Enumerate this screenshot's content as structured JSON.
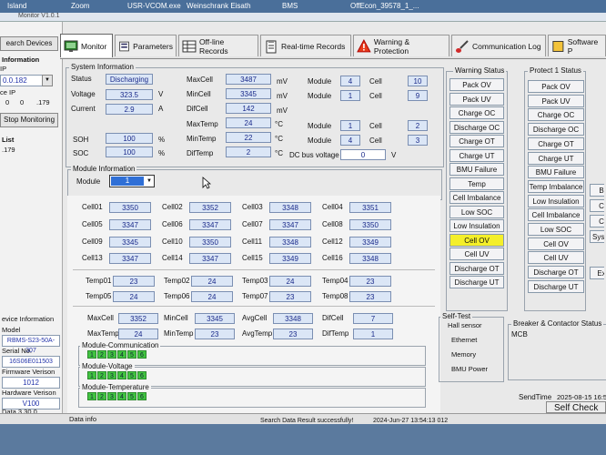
{
  "desktop": {
    "items": [
      "Island",
      "Zoom",
      "USR-VCOM.exe",
      "Weinschrank Eisath",
      "BMS",
      "OffEcon_39578_1_..."
    ]
  },
  "window": {
    "title": "Monitor V1.0.1"
  },
  "tabs": [
    {
      "label": "Monitor",
      "icon": "monitor-icon"
    },
    {
      "label": "Parameters",
      "icon": "parameters-icon"
    },
    {
      "label": "Off-line Records",
      "icon": "table-icon"
    },
    {
      "label": "Real-time Records",
      "icon": "clipboard-icon"
    },
    {
      "label": "Warning & Protection",
      "icon": "warning-icon"
    },
    {
      "label": "Communication Log",
      "icon": "brush-icon"
    },
    {
      "label": "Software P",
      "icon": "software-icon"
    }
  ],
  "left": {
    "search_devices": "earch Devices",
    "information": "Information",
    "ip_label": "IP",
    "ip_value": "0.0.182",
    "ce_ip": "ce IP",
    "ce_ip_parts": [
      "0",
      "0",
      ".179"
    ],
    "stop_monitoring": "Stop Monitoring",
    "list_label": "List",
    "list_item": ".179",
    "device_information": "evice Information",
    "model_label": "Model",
    "model_value": "RBMS-S23-50A-307",
    "serial_label": "Serial No.",
    "serial_value": "16S06E011503",
    "firmware_label": "Firmware Verison",
    "firmware_value": "1012",
    "hardware_label": "Hardware Verison",
    "hardware_value": "V100",
    "date_version": "Data 3.30.0"
  },
  "system_info": {
    "title": "System Information",
    "status_label": "Status",
    "status_value": "Discharging",
    "voltage_label": "Voltage",
    "voltage_value": "323.5",
    "voltage_unit": "V",
    "current_label": "Current",
    "current_value": "2.9",
    "current_unit": "A",
    "soh_label": "SOH",
    "soh_value": "100",
    "soh_unit": "%",
    "soc_label": "SOC",
    "soc_value": "100",
    "soc_unit": "%",
    "maxcell_label": "MaxCell",
    "maxcell_value": "3487",
    "maxcell_unit": "mV",
    "mincell_label": "MinCell",
    "mincell_value": "3345",
    "mincell_unit": "mV",
    "difcell_label": "DifCell",
    "difcell_value": "142",
    "difcell_unit": "mV",
    "maxtemp_label": "MaxTemp",
    "maxtemp_value": "24",
    "maxtemp_unit": "°C",
    "mintemp_label": "MinTemp",
    "mintemp_value": "22",
    "mintemp_unit": "°C",
    "diftemp_label": "DifTemp",
    "diftemp_value": "2",
    "diftemp_unit": "°C",
    "module_label": "Module",
    "cell_label": "Cell",
    "maxcell_module": "4",
    "maxcell_cell": "10",
    "mincell_module": "1",
    "mincell_cell": "9",
    "maxtemp_module": "1",
    "maxtemp_cell": "2",
    "mintemp_module": "4",
    "mintemp_cell": "3",
    "dcbus_label": "DC bus voltage",
    "dcbus_value": "0",
    "dcbus_unit": "V"
  },
  "module_info": {
    "title": "Module Information",
    "module_label": "Module",
    "module_selected": "1",
    "cells": [
      {
        "label": "Cell01",
        "value": "3350"
      },
      {
        "label": "Cell02",
        "value": "3352"
      },
      {
        "label": "Cell03",
        "value": "3348"
      },
      {
        "label": "Cell04",
        "value": "3351"
      },
      {
        "label": "Cell05",
        "value": "3347"
      },
      {
        "label": "Cell06",
        "value": "3347"
      },
      {
        "label": "Cell07",
        "value": "3347"
      },
      {
        "label": "Cell08",
        "value": "3350"
      },
      {
        "label": "Cell09",
        "value": "3345"
      },
      {
        "label": "Cell10",
        "value": "3350"
      },
      {
        "label": "Cell11",
        "value": "3348"
      },
      {
        "label": "Cell12",
        "value": "3349"
      },
      {
        "label": "Cell13",
        "value": "3347"
      },
      {
        "label": "Cell14",
        "value": "3347"
      },
      {
        "label": "Cell15",
        "value": "3349"
      },
      {
        "label": "Cell16",
        "value": "3348"
      }
    ],
    "temps": [
      {
        "label": "Temp01",
        "value": "23"
      },
      {
        "label": "Temp02",
        "value": "24"
      },
      {
        "label": "Temp03",
        "value": "24"
      },
      {
        "label": "Temp04",
        "value": "23"
      },
      {
        "label": "Temp05",
        "value": "24"
      },
      {
        "label": "Temp06",
        "value": "24"
      },
      {
        "label": "Temp07",
        "value": "23"
      },
      {
        "label": "Temp08",
        "value": "23"
      }
    ],
    "summary": [
      {
        "label": "MaxCell",
        "value": "3352"
      },
      {
        "label": "MinCell",
        "value": "3345"
      },
      {
        "label": "AvgCell",
        "value": "3348"
      },
      {
        "label": "DifCell",
        "value": "7"
      },
      {
        "label": "MaxTemp",
        "value": "24"
      },
      {
        "label": "MinTemp",
        "value": "23"
      },
      {
        "label": "AvgTemp",
        "value": "23"
      },
      {
        "label": "DifTemp",
        "value": "1"
      }
    ],
    "comm_title": "Module-Communication",
    "voltage_title": "Module-Voltage",
    "temperature_title": "Module-Temperature",
    "indicators": [
      "1",
      "2",
      "3",
      "4",
      "5",
      "6"
    ]
  },
  "warning_status": {
    "title": "Warning Status",
    "items": [
      "Pack OV",
      "Pack UV",
      "Charge OC",
      "Discharge OC",
      "Charge OT",
      "Charge UT",
      "BMU Failure",
      "Temp Imbalance",
      "Cell Imbalance",
      "Low SOC",
      "Low Insulation",
      "Cell OV",
      "Cell UV",
      "Discharge OT",
      "Discharge UT"
    ],
    "active": "Cell OV",
    "active_color": "#f4ef2a"
  },
  "protect_status": {
    "title": "Protect 1 Status",
    "items": [
      "Pack OV",
      "Pack UV",
      "Charge OC",
      "Discharge OC",
      "Charge OT",
      "Charge UT",
      "BMU Failure",
      "Temp Imbalance",
      "Low Insulation",
      "Cell Imbalance",
      "Low SOC",
      "Cell OV",
      "Cell UV",
      "Discharge OT",
      "Discharge UT"
    ]
  },
  "protect_partial": {
    "items": [
      "B",
      "C",
      "C",
      "Syste",
      "Ex"
    ]
  },
  "self_test": {
    "title": "Self-Test",
    "items": [
      "Hall sensor",
      "Ethernet",
      "Memory",
      "BMU Power"
    ]
  },
  "breaker": {
    "title": "Breaker & Contactor Status",
    "mcb": "MCB"
  },
  "send_time": {
    "label": "SendTime",
    "value": "2025-08-15 16:5"
  },
  "self_check": "Self Check O",
  "status_bar": {
    "left": "Data info",
    "message": "Search Data Result successfully!",
    "timestamp": "2024-Jun-27 13:54:13 012"
  }
}
